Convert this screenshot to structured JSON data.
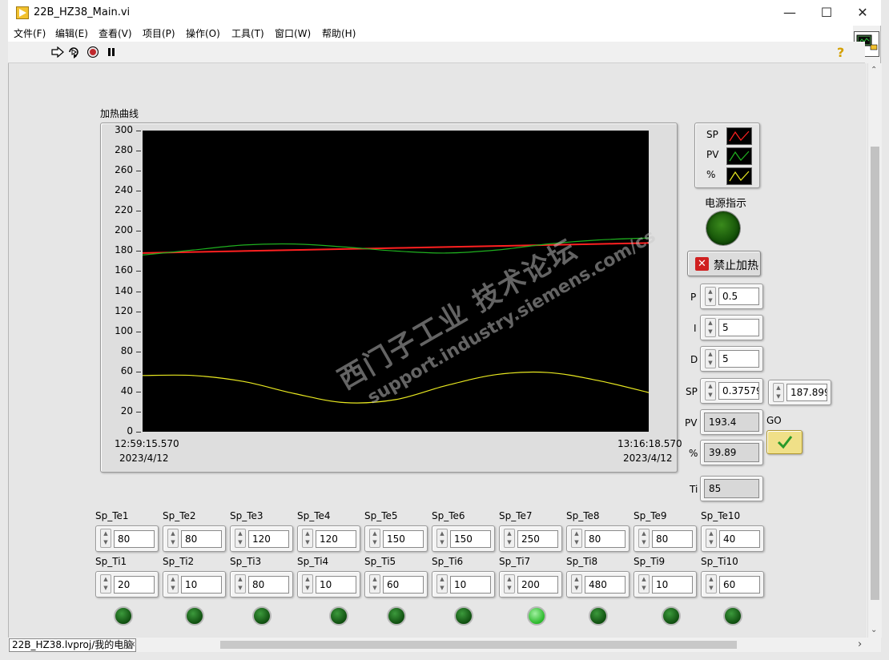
{
  "window": {
    "title": "22B_HZ38_Main.vi"
  },
  "menu": [
    "文件(F)",
    "编辑(E)",
    "查看(V)",
    "项目(P)",
    "操作(O)",
    "工具(T)",
    "窗口(W)",
    "帮助(H)"
  ],
  "graph": {
    "title": "加热曲线"
  },
  "chart_data": {
    "type": "line",
    "title": "加热曲线",
    "y_ticks": [
      "300",
      "280",
      "260",
      "240",
      "220",
      "200",
      "180",
      "160",
      "140",
      "120",
      "100",
      "80",
      "60",
      "40",
      "20",
      "0"
    ],
    "ylim": [
      0,
      300
    ],
    "x_start": {
      "time": "12:59:15.570",
      "date": "2023/4/12"
    },
    "x_end": {
      "time": "13:16:18.570",
      "date": "2023/4/12"
    },
    "x": [
      0,
      0.1,
      0.2,
      0.3,
      0.4,
      0.5,
      0.6,
      0.7,
      0.8,
      0.9,
      1.0
    ],
    "series": [
      {
        "name": "SP",
        "color": "#ff2020",
        "values": [
          178,
          179,
          180,
          181,
          182,
          183,
          184,
          185,
          186,
          187,
          188
        ]
      },
      {
        "name": "PV",
        "color": "#1fb01f",
        "values": [
          176,
          181,
          186,
          187,
          184,
          180,
          178,
          181,
          187,
          191,
          193
        ]
      },
      {
        "name": "%",
        "color": "#e8e820",
        "values": [
          56,
          56,
          50,
          38,
          29,
          32,
          46,
          57,
          59,
          51,
          39
        ]
      }
    ],
    "legend_position": "right"
  },
  "power": {
    "label": "电源指示"
  },
  "stop_button": {
    "label": "禁止加热"
  },
  "pid": {
    "p": {
      "label": "P",
      "value": "0.5"
    },
    "i": {
      "label": "I",
      "value": "5"
    },
    "d": {
      "label": "D",
      "value": "5"
    },
    "sp": {
      "label": "SP",
      "value": "0.37579",
      "value2": "187.899"
    },
    "pv": {
      "label": "PV",
      "value": "193.4"
    },
    "pct": {
      "label": "%",
      "value": "39.89"
    },
    "ti": {
      "label": "Ti",
      "value": "85"
    },
    "go_label": "GO"
  },
  "te": [
    {
      "label": "Sp_Te1",
      "value": "80"
    },
    {
      "label": "Sp_Te2",
      "value": "80"
    },
    {
      "label": "Sp_Te3",
      "value": "120"
    },
    {
      "label": "Sp_Te4",
      "value": "120"
    },
    {
      "label": "Sp_Te5",
      "value": "150"
    },
    {
      "label": "Sp_Te6",
      "value": "150"
    },
    {
      "label": "Sp_Te7",
      "value": "250"
    },
    {
      "label": "Sp_Te8",
      "value": "80"
    },
    {
      "label": "Sp_Te9",
      "value": "80"
    },
    {
      "label": "Sp_Te10",
      "value": "40"
    }
  ],
  "ti": [
    {
      "label": "Sp_Ti1",
      "value": "20"
    },
    {
      "label": "Sp_Ti2",
      "value": "10"
    },
    {
      "label": "Sp_Ti3",
      "value": "80"
    },
    {
      "label": "Sp_Ti4",
      "value": "10"
    },
    {
      "label": "Sp_Ti5",
      "value": "60"
    },
    {
      "label": "Sp_Ti6",
      "value": "10"
    },
    {
      "label": "Sp_Ti7",
      "value": "200"
    },
    {
      "label": "Sp_Ti8",
      "value": "480"
    },
    {
      "label": "Sp_Ti9",
      "value": "10"
    },
    {
      "label": "Sp_Ti10",
      "value": "60"
    }
  ],
  "leds_on": [
    false,
    false,
    false,
    false,
    false,
    false,
    true,
    false,
    false,
    false
  ],
  "watermark": {
    "line1": "西门子工业 技术论坛",
    "line2": "support.industry.siemens.com/cs"
  },
  "statusbar": {
    "path": "22B_HZ38.lvproj/我的电脑"
  }
}
